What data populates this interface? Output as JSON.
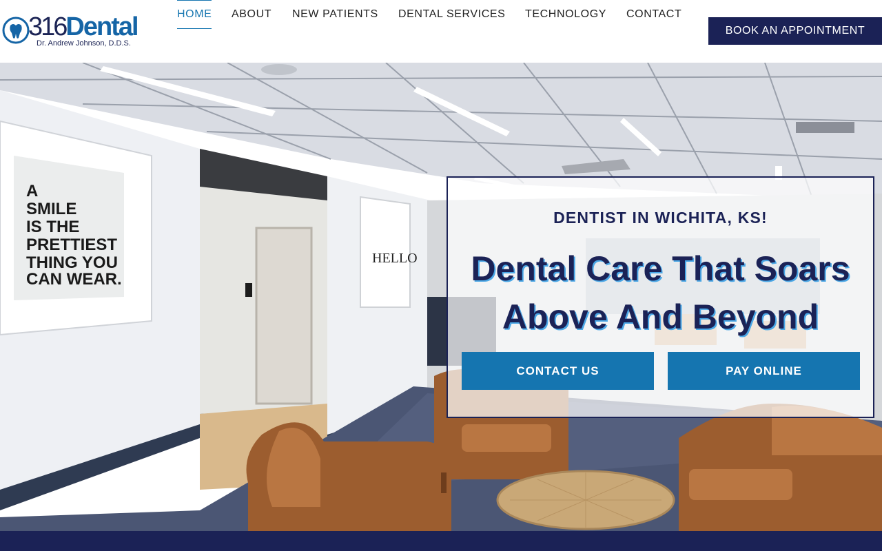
{
  "brand": {
    "name_number": "316",
    "name_word": "Dental",
    "doctor": "Dr. Andrew Johnson, D.D.S."
  },
  "nav": {
    "items": [
      {
        "label": "HOME",
        "active": true
      },
      {
        "label": "ABOUT"
      },
      {
        "label": "NEW PATIENTS"
      },
      {
        "label": "DENTAL SERVICES"
      },
      {
        "label": "TECHNOLOGY"
      },
      {
        "label": "CONTACT"
      }
    ],
    "book_label": "BOOK AN APPOINTMENT"
  },
  "hero": {
    "kicker": "DENTIST IN WICHITA, KS!",
    "headline_line1": "Dental Care That Soars",
    "headline_line2": "Above And Beyond",
    "contact_label": "CONTACT US",
    "pay_label": "PAY ONLINE",
    "poster_lines": [
      "A",
      "SMILE",
      "IS THE",
      "PRETTIEST",
      "THING YOU",
      "CAN WEAR."
    ],
    "sign_word": "HELLO"
  },
  "colors": {
    "navy": "#1b2256",
    "accent_blue": "#1575b0",
    "logo_blue": "#1565a6"
  }
}
